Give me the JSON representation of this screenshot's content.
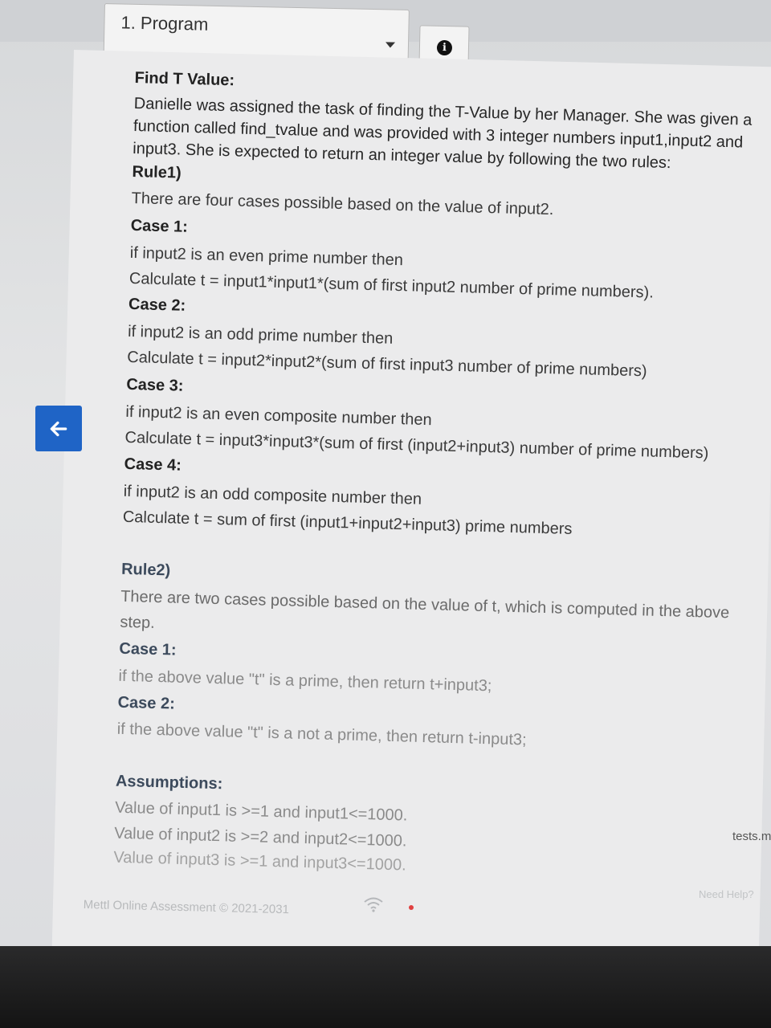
{
  "header": {
    "program_label": "1. Program"
  },
  "icons": {
    "caret": "chevron-down-icon",
    "info": "info-icon",
    "back": "arrow-left-icon",
    "wifi": "wifi-icon"
  },
  "colors": {
    "back_button": "#1f64c6",
    "status_dot": "#e04040"
  },
  "problem": {
    "title": "Find T Value:",
    "intro": [
      "Danielle was assigned the task of finding the T-Value by her Manager. She was given a",
      "function called find_tvalue and was provided with 3 integer numbers input1,input2 and",
      "input3. She is expected to return an integer value by following the two rules:"
    ],
    "rule1": {
      "title": "Rule1)",
      "description": "There are four cases possible based on the value of input2.",
      "cases": [
        {
          "title": "Case 1:",
          "condition": "if input2 is an even prime number then",
          "calc": "Calculate t = input1*input1*(sum of first input2 number of prime numbers)."
        },
        {
          "title": "Case 2:",
          "condition": "if input2 is an odd prime number then",
          "calc": "Calculate t = input2*input2*(sum of first input3 number of prime numbers)"
        },
        {
          "title": "Case 3:",
          "condition": "if input2 is an even composite number then",
          "calc": "Calculate t = input3*input3*(sum of first (input2+input3) number of prime numbers)"
        },
        {
          "title": "Case 4:",
          "condition": "if input2 is an odd composite number then",
          "calc": "Calculate t = sum of first (input1+input2+input3) prime numbers"
        }
      ]
    },
    "rule2": {
      "title": "Rule2)",
      "description_1": "There are two cases possible based on the value of t, which is computed in the above",
      "description_2": "step.",
      "cases": [
        {
          "title": "Case 1:",
          "text": "if the above value \"t\" is a prime, then return t+input3;"
        },
        {
          "title": "Case 2:",
          "text": "if the above value \"t\" is a not a prime, then return t-input3;"
        }
      ]
    },
    "assumptions": {
      "title": "Assumptions:",
      "items": [
        "Value of input1 is >=1 and input1<=1000.",
        "Value of input2 is >=2 and input2<=1000.",
        "Value of input3 is >=1 and input3<=1000."
      ]
    }
  },
  "footer": {
    "copyright": "Mettl Online Assessment © 2021-2031",
    "tests_link": "tests.m",
    "help_link": "Need Help?"
  }
}
